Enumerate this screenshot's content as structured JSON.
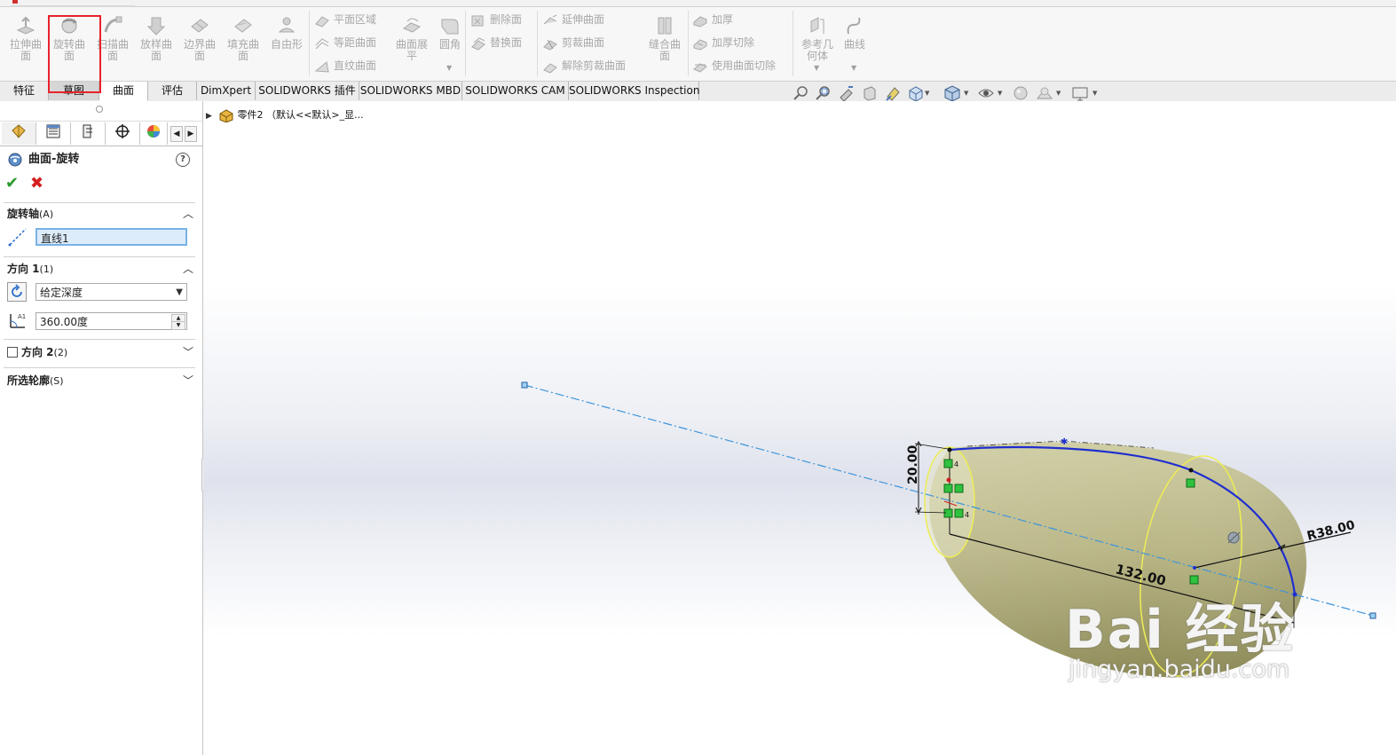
{
  "ribbon": {
    "big_buttons": [
      {
        "label": "拉伸曲\n面",
        "icon": "extrude-surface-icon"
      },
      {
        "label": "旋转曲\n面",
        "icon": "revolve-surface-icon"
      },
      {
        "label": "扫描曲\n面",
        "icon": "sweep-surface-icon"
      },
      {
        "label": "放样曲\n面",
        "icon": "loft-surface-icon"
      },
      {
        "label": "边界曲\n面",
        "icon": "boundary-surface-icon"
      },
      {
        "label": "填充曲\n面",
        "icon": "fill-surface-icon"
      },
      {
        "label": "自由形",
        "icon": "freeform-icon"
      }
    ],
    "group1": [
      "平面区域",
      "等距曲面",
      "直纹曲面"
    ],
    "flatten": "曲面展\n平",
    "fillet": "圆角",
    "group2": [
      "删除面",
      "替换面"
    ],
    "group3": [
      "延伸曲面",
      "剪裁曲面",
      "解除剪裁曲面"
    ],
    "knit": "缝合曲\n面",
    "group4": [
      "加厚",
      "加厚切除",
      "使用曲面切除"
    ],
    "ref_geometry": "参考几\n何体",
    "curves": "曲线"
  },
  "tabs": [
    {
      "label": "特征"
    },
    {
      "label": "草图"
    },
    {
      "label": "曲面"
    },
    {
      "label": "评估"
    },
    {
      "label": "DimXpert"
    },
    {
      "label": "SOLIDWORKS 插件"
    },
    {
      "label": "SOLIDWORKS MBD"
    },
    {
      "label": "SOLIDWORKS CAM"
    },
    {
      "label": "SOLIDWORKS Inspection"
    }
  ],
  "active_tab": "曲面",
  "property_manager": {
    "title": "曲面-旋转",
    "help": "?",
    "ok": "✔",
    "cancel": "✖",
    "axis_section": {
      "title": "旋转轴",
      "key": "(A)",
      "value": "直线1"
    },
    "direction1": {
      "title": "方向 1",
      "key": "(1)",
      "end_condition": "给定深度",
      "angle": "360.00度"
    },
    "direction2": {
      "title": "方向 2",
      "key": "(2)",
      "checked": false
    },
    "contours": {
      "title": "所选轮廓",
      "key": "(S)"
    }
  },
  "tree": {
    "part_label": "零件2 （默认<<默认>_显..."
  },
  "dimensions": {
    "height": "20.00",
    "length": "132.00",
    "radius": "R38.00"
  },
  "relation_marks": [
    "4",
    "4"
  ],
  "watermark": {
    "main": "Bai 经验",
    "sub": "jingyan.baidu.com"
  },
  "colors": {
    "highlight_box": "#e8222a",
    "surface": "#b8b585",
    "profile_line": "#1f2ecf",
    "axis_line": "#2d8fd8",
    "relation": "#2fc23f",
    "edge": "#f0ef5e"
  }
}
